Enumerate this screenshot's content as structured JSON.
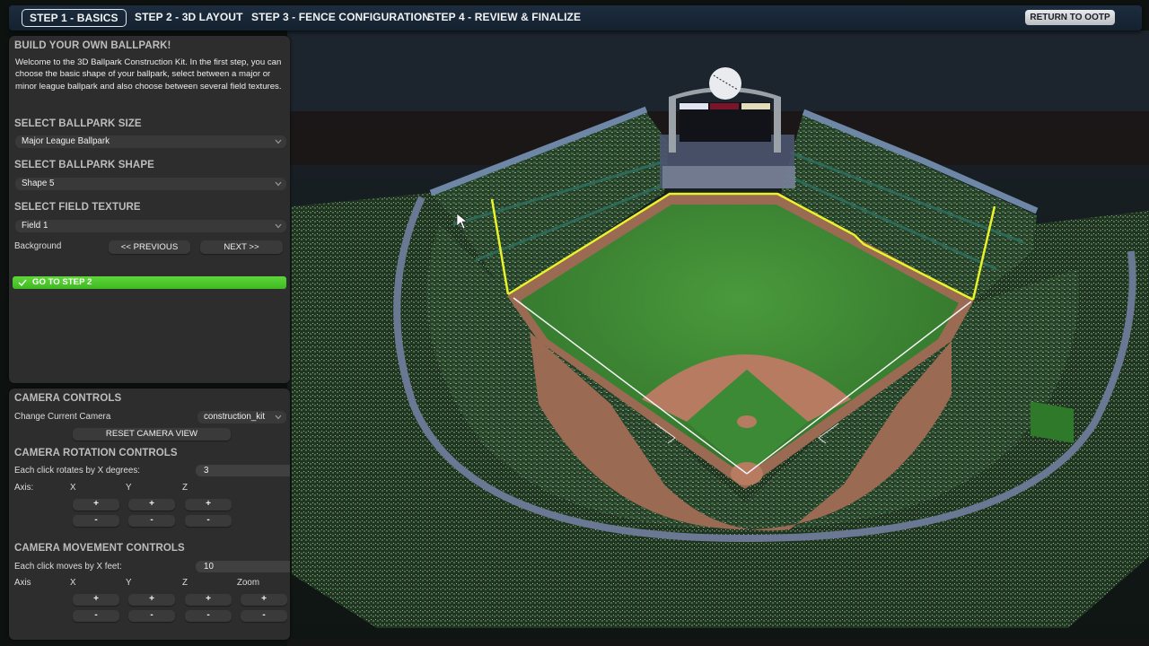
{
  "nav": {
    "steps": [
      {
        "label": "STEP 1 - BASICS",
        "active": true
      },
      {
        "label": "STEP 2 - 3D LAYOUT",
        "active": false
      },
      {
        "label": "STEP 3 - FENCE CONFIGURATION",
        "active": false
      },
      {
        "label": "STEP 4 - REVIEW & FINALIZE",
        "active": false
      }
    ],
    "return_label": "RETURN TO OOTP"
  },
  "basics": {
    "title": "BUILD YOUR OWN BALLPARK!",
    "intro": "Welcome to the 3D Ballpark Construction Kit. In the first step, you can choose the basic shape of your ballpark, select between a major or minor league ballpark and also choose between several field textures.",
    "size": {
      "label": "SELECT BALLPARK SIZE",
      "value": "Major League Ballpark"
    },
    "shape": {
      "label": "SELECT BALLPARK SHAPE",
      "value": "Shape 5"
    },
    "texture": {
      "label": "SELECT FIELD TEXTURE",
      "value": "Field 1"
    },
    "background": {
      "label": "Background",
      "previous": "<< PREVIOUS",
      "next": "NEXT >>"
    },
    "go_label": "GO TO STEP 2"
  },
  "camera": {
    "title": "CAMERA CONTROLS",
    "change_label": "Change Current Camera",
    "camera_value": "construction_kit",
    "reset_label": "RESET CAMERA VIEW",
    "rotation": {
      "title": "CAMERA ROTATION CONTROLS",
      "step_label": "Each click rotates by X degrees:",
      "step_value": "3",
      "axis_label": "Axis:",
      "axes": [
        "X",
        "Y",
        "Z"
      ],
      "plus": "+",
      "minus": "-"
    },
    "movement": {
      "title": "CAMERA MOVEMENT CONTROLS",
      "step_label": "Each click moves by X feet:",
      "step_value": "10",
      "axis_label": "Axis",
      "axes": [
        "X",
        "Y",
        "Z",
        "Zoom"
      ],
      "plus": "+",
      "minus": "-"
    }
  },
  "scene": {
    "description": "3D ballpark preview",
    "colors": {
      "grass": "#3f8a34",
      "dirt": "#a86a52",
      "fence_top": "#e6f22a",
      "stands": "#2c4a2a",
      "concourse": "#6b7894",
      "accent_green": "#46c52a"
    }
  }
}
